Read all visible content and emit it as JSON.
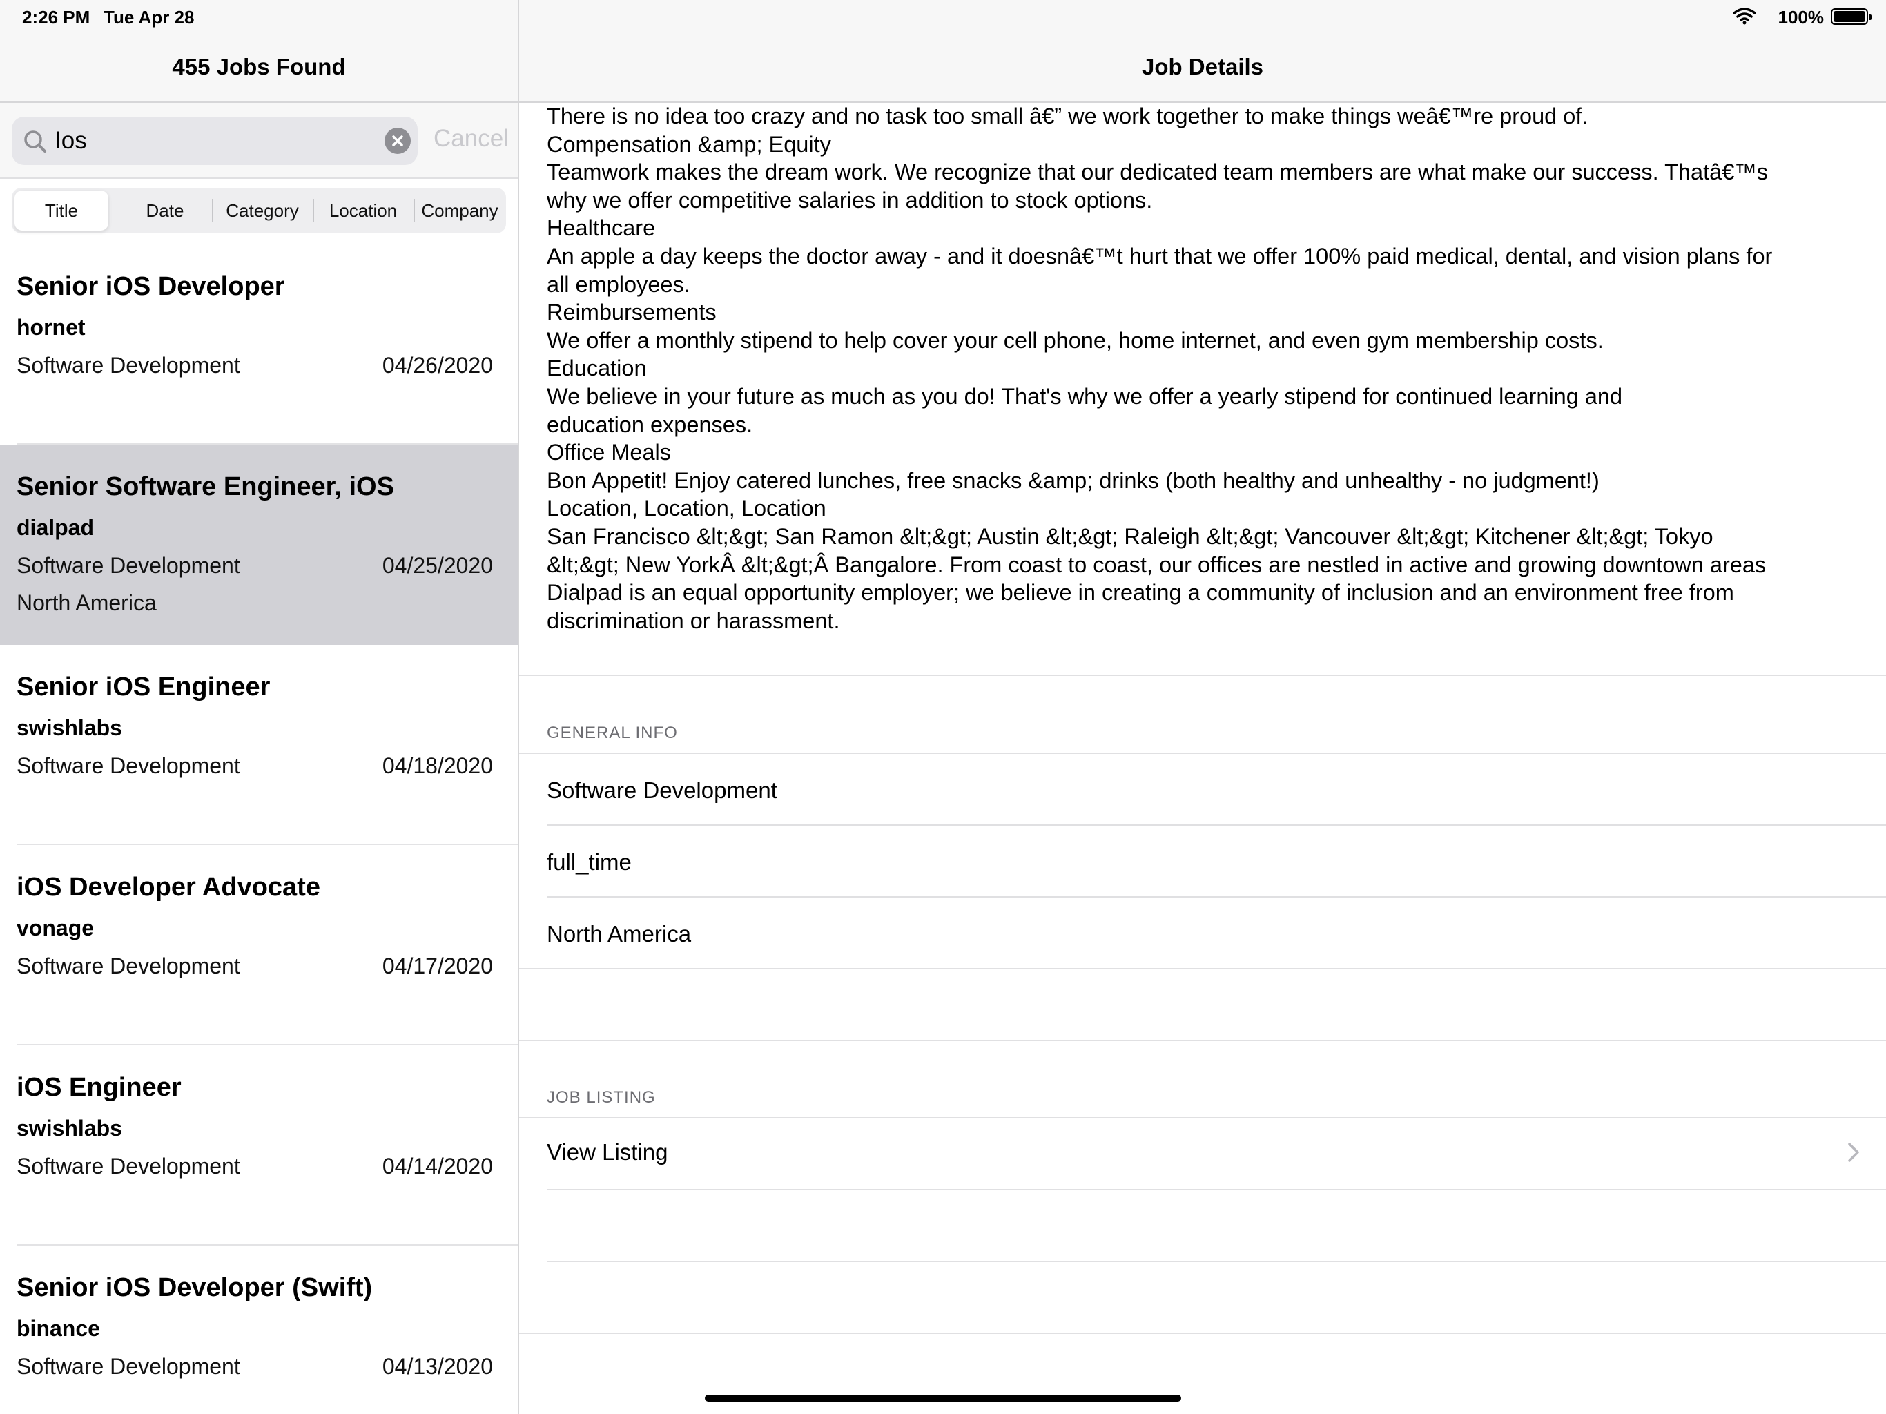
{
  "status_bar": {
    "time": "2:26 PM",
    "date": "Tue Apr 28",
    "battery_percent": "100%",
    "wifi_icon": "wifi-icon",
    "battery_icon": "battery-icon",
    "battery_level": 1.0
  },
  "master": {
    "title": "455 Jobs Found",
    "search": {
      "value": "Ios",
      "cancel_label": "Cancel"
    },
    "sort_segments": [
      "Title",
      "Date",
      "Category",
      "Location",
      "Company"
    ],
    "selected_segment": "Title",
    "jobs": [
      {
        "title": "Senior iOS Developer",
        "company": "hornet",
        "category": "Software Development",
        "date": "04/26/2020",
        "location": ""
      },
      {
        "title": "Senior Software Engineer, iOS",
        "company": "dialpad",
        "category": "Software Development",
        "date": "04/25/2020",
        "location": "North America"
      },
      {
        "title": "Senior iOS Engineer",
        "company": "swishlabs",
        "category": "Software Development",
        "date": "04/18/2020",
        "location": ""
      },
      {
        "title": "iOS Developer Advocate",
        "company": "vonage",
        "category": "Software Development",
        "date": "04/17/2020",
        "location": ""
      },
      {
        "title": "iOS Engineer",
        "company": "swishlabs",
        "category": "Software Development",
        "date": "04/14/2020",
        "location": ""
      },
      {
        "title": "Senior iOS Developer (Swift)",
        "company": "binance",
        "category": "Software Development",
        "date": "04/13/2020",
        "location": ""
      }
    ]
  },
  "detail": {
    "title": "Job Details",
    "description_lines": [
      "There is no idea too crazy and no task too small â€” we work together to make things weâ€™re proud of.",
      "Compensation &amp; Equity",
      "Teamwork makes the dream work. We recognize that our dedicated team members are what make our success. Thatâ€™s",
      "why we offer competitive salaries in addition to stock options.",
      "Healthcare",
      "An apple a day keeps the doctor away - and it doesnâ€™t hurt that we offer 100% paid medical, dental, and vision plans for",
      "all employees.",
      "Reimbursements",
      "We offer a monthly stipend to help cover your cell phone, home internet, and even gym membership costs.",
      "Education",
      "We believe in your future as much as you do! That's why we offer a yearly stipend for continued learning and",
      "education expenses.",
      "Office Meals",
      "Bon Appetit! Enjoy catered lunches, free snacks &amp; drinks (both healthy and unhealthy - no judgment!)",
      "Location, Location, Location",
      "San Francisco &lt;&gt; San Ramon &lt;&gt; Austin &lt;&gt; Raleigh &lt;&gt; Vancouver &lt;&gt; Kitchener &lt;&gt; Tokyo",
      "&lt;&gt; New YorkÂ &lt;&gt;Â Bangalore. From coast to coast, our offices are nestled in active and growing downtown areas",
      "Dialpad is an equal opportunity employer; we believe in creating a community of inclusion and an environment free from",
      "discrimination or harassment."
    ],
    "general_info": {
      "header": "GENERAL INFO",
      "category": "Software Development",
      "type": "full_time",
      "location": "North America"
    },
    "job_listing": {
      "header": "JOB LISTING",
      "view_label": "View Listing"
    }
  }
}
